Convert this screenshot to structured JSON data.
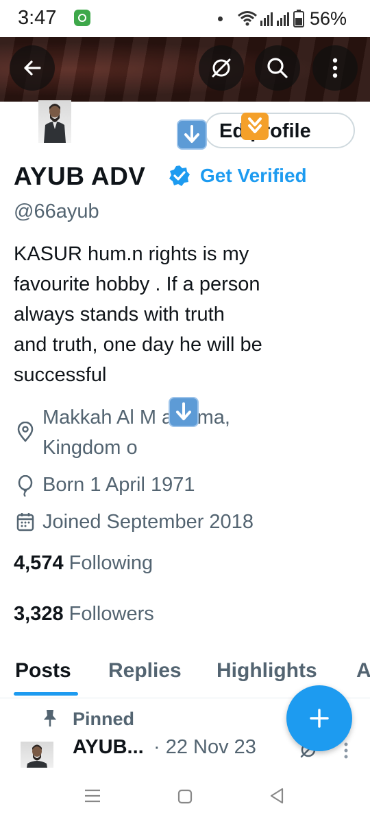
{
  "status_bar": {
    "time": "3:47",
    "battery": "56%"
  },
  "header": {
    "back_icon": "arrow-left-icon",
    "grok_icon": "slashed-circle-icon",
    "search_icon": "search-icon",
    "more_icon": "more-vertical-icon"
  },
  "profile": {
    "edit_button_label": "Ed   profile",
    "display_name": "AYUB ADV",
    "get_verified": "Get Verified",
    "handle": "@66ayub",
    "bio_lines": [
      "KASUR  hum.n rights is my",
      "favourite hobby . If a person",
      "always stands with truth",
      "and truth, one day he will be",
      "successful"
    ],
    "location_line1": "Makkah Al M     arrama,",
    "location_line2": "Kingdom o",
    "birthday": "Born 1 April 1971",
    "joined": "Joined September 2018",
    "following_count": "4,574",
    "following_label": "Following",
    "followers_count": "3,328",
    "followers_label": "Followers"
  },
  "tabs": [
    {
      "label": "Posts",
      "active": true
    },
    {
      "label": "Replies",
      "active": false
    },
    {
      "label": "Highlights",
      "active": false
    },
    {
      "label": "A",
      "active": false
    }
  ],
  "pinned_post": {
    "pinned_label": "Pinned",
    "author": "AYUB...",
    "date": "· 22 Nov 23"
  },
  "colors": {
    "accent": "#1d9bf0",
    "text_primary": "#0f1419",
    "text_secondary": "#536471"
  }
}
